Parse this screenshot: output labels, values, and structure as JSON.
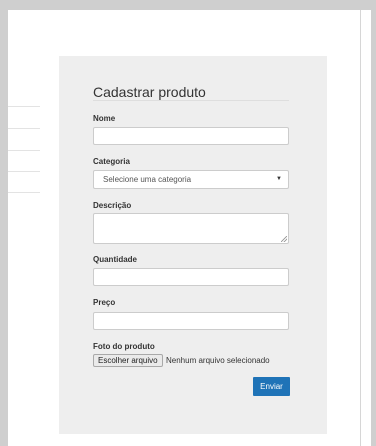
{
  "form": {
    "title": "Cadastrar produto",
    "fields": {
      "nome": {
        "label": "Nome",
        "value": ""
      },
      "categoria": {
        "label": "Categoria",
        "selected": "Selecione uma categoria"
      },
      "descricao": {
        "label": "Descrição",
        "value": ""
      },
      "quantidade": {
        "label": "Quantidade",
        "value": ""
      },
      "preco": {
        "label": "Preço",
        "value": ""
      },
      "foto": {
        "label": "Foto do produto",
        "button_label": "Escolher arquivo",
        "status": "Nenhum arquivo selecionado"
      }
    },
    "submit_label": "Enviar"
  },
  "colors": {
    "panel_background": "#eeeeee",
    "submit_button": "#1f73b7",
    "page_frame": "#cfcfcf"
  },
  "icons": {
    "select_caret": "chevron-down-icon",
    "textarea_resize": "resize-grip-icon"
  }
}
